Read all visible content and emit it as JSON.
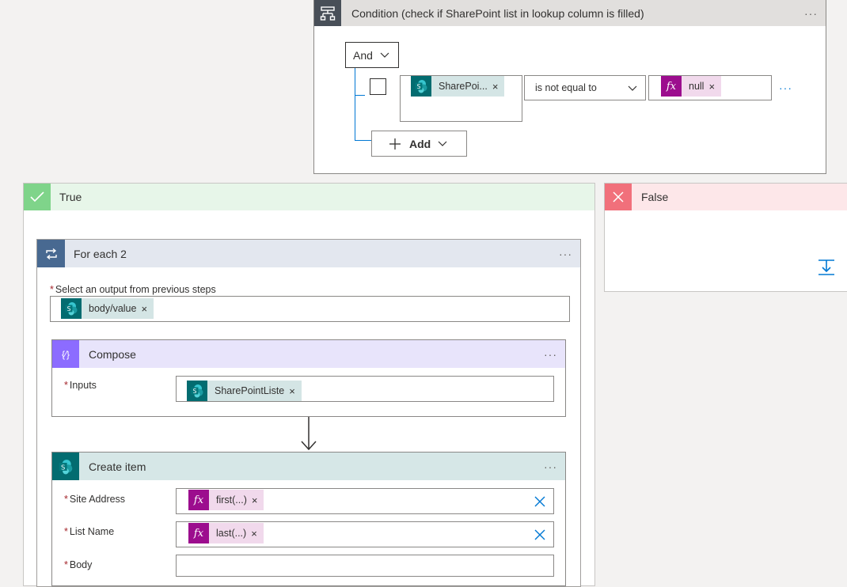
{
  "condition": {
    "title": "Condition (check if SharePoint list in lookup column is filled)",
    "group_operator": "And",
    "row": {
      "left_token": "SharePoi...",
      "operator": "is not equal to",
      "right_token": "null"
    },
    "add_label": "Add"
  },
  "true_branch": {
    "title": "True"
  },
  "false_branch": {
    "title": "False"
  },
  "foreach": {
    "title": "For each 2",
    "select_label": "Select an output from previous steps",
    "select_token": "body/value"
  },
  "compose": {
    "title": "Compose",
    "inputs_label": "Inputs",
    "inputs_token": "SharePointListe"
  },
  "create_item": {
    "title": "Create item",
    "site_address_label": "Site Address",
    "site_address_token": "first(...)",
    "list_name_label": "List Name",
    "list_name_token": "last(...)",
    "body_label": "Body"
  },
  "symbols": {
    "required": "*",
    "remove": "×",
    "more": "···",
    "fx": "fx",
    "compose_glyph": "{⁄}"
  },
  "colors": {
    "condition_header": "#e1dfdd",
    "true_header": "#e7f6e9",
    "true_accent": "#7fd48a",
    "false_header": "#fde7e9",
    "false_accent": "#f1707b",
    "foreach_header": "#e3e7ef",
    "foreach_accent": "#486991",
    "compose_header": "#e8e4fb",
    "compose_accent": "#8c6cff",
    "sharepoint_header": "#d6e7e7",
    "sharepoint_accent": "#036c70",
    "fx_accent": "#9c0d8e",
    "link_blue": "#0078d4"
  }
}
